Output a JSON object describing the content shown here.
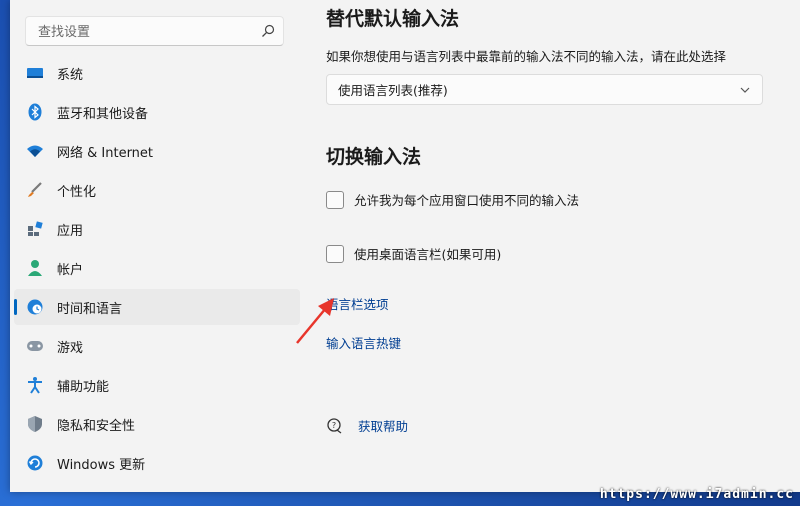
{
  "sidebar": {
    "search_placeholder": "查找设置",
    "items": [
      {
        "label": "系统",
        "icon": "monitor-icon",
        "selected": false
      },
      {
        "label": "蓝牙和其他设备",
        "icon": "bluetooth-icon",
        "selected": false
      },
      {
        "label": "网络 & Internet",
        "icon": "wifi-icon",
        "selected": false
      },
      {
        "label": "个性化",
        "icon": "brush-icon",
        "selected": false
      },
      {
        "label": "应用",
        "icon": "apps-icon",
        "selected": false
      },
      {
        "label": "帐户",
        "icon": "person-icon",
        "selected": false
      },
      {
        "label": "时间和语言",
        "icon": "globe-clock-icon",
        "selected": true
      },
      {
        "label": "游戏",
        "icon": "gamepad-icon",
        "selected": false
      },
      {
        "label": "辅助功能",
        "icon": "accessibility-icon",
        "selected": false
      },
      {
        "label": "隐私和安全性",
        "icon": "shield-icon",
        "selected": false
      },
      {
        "label": "Windows 更新",
        "icon": "update-icon",
        "selected": false
      }
    ]
  },
  "main": {
    "override_section": {
      "title": "替代默认输入法",
      "description": "如果你想使用与语言列表中最靠前的输入法不同的输入法，请在此处选择",
      "select_value": "使用语言列表(推荐)"
    },
    "switch_section": {
      "title": "切换输入法",
      "checkbox_per_app": {
        "label": "允许我为每个应用窗口使用不同的输入法",
        "checked": false
      },
      "checkbox_language_bar": {
        "label": "使用桌面语言栏(如果可用)",
        "checked": false
      },
      "link_language_bar_options": "语言栏选项",
      "link_hotkeys": "输入语言热键"
    },
    "help": {
      "label": "获取帮助"
    }
  },
  "watermark": "https://www.i7admin.cc",
  "colors": {
    "accent": "#0067c0",
    "link": "#003e92",
    "arrow": "#e8352b"
  }
}
